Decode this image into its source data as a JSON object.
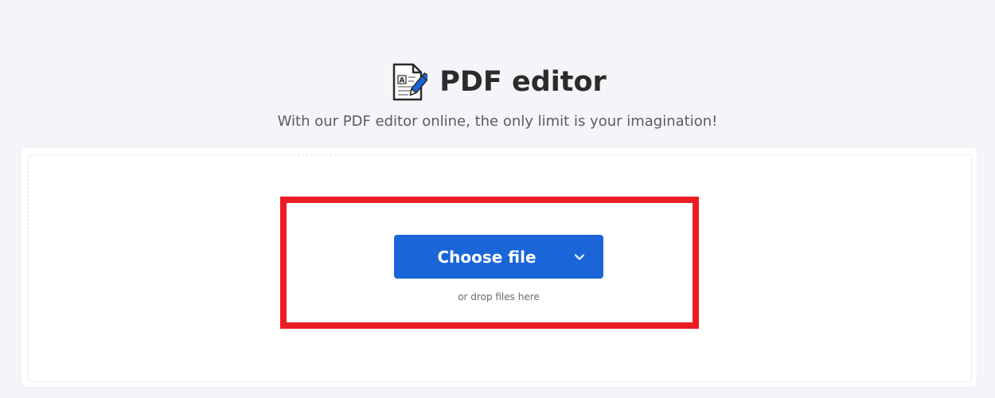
{
  "header": {
    "title": "PDF editor",
    "subtitle": "With our PDF editor online, the only limit is your imagination!",
    "icon": "pdf-edit-document-icon"
  },
  "upload": {
    "button_label": "Choose file",
    "button_icon": "chevron-down-icon",
    "drop_hint": "or drop files here"
  },
  "colors": {
    "background": "#f4f5f9",
    "button": "#1a66d9",
    "highlight": "#ec1c24",
    "title": "#2b2b2b"
  }
}
